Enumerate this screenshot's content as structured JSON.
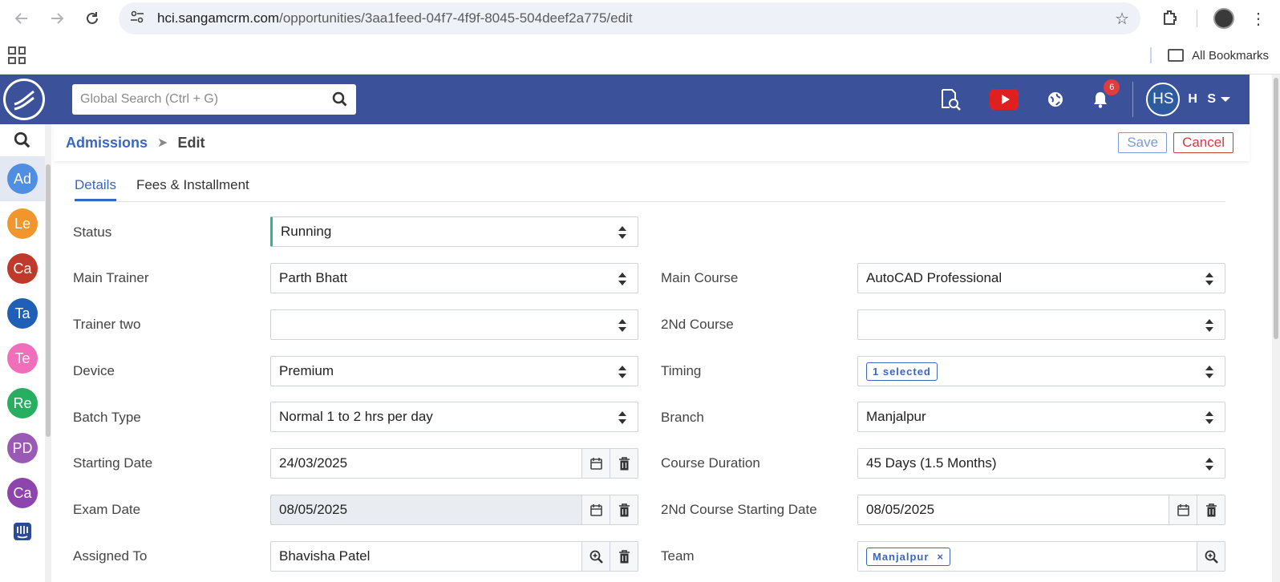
{
  "browser": {
    "url_host": "hci.sangamcrm.com",
    "url_path": "/opportunities/3aa1feed-04f7-4f9f-8045-504deef2a775/edit",
    "bookmarks_label": "All Bookmarks"
  },
  "header": {
    "search_placeholder": "Global Search (Ctrl + G)",
    "notification_count": "6",
    "avatar_initials": "HS",
    "user_name": "H S",
    "brand_color": "#3b5199"
  },
  "sidebar": {
    "items": [
      {
        "label": "Ad",
        "color": "#4f8ee0"
      },
      {
        "label": "Le",
        "color": "#f0962c"
      },
      {
        "label": "Ca",
        "color": "#c0392b"
      },
      {
        "label": "Ta",
        "color": "#1f5fb5"
      },
      {
        "label": "Te",
        "color": "#f16fba"
      },
      {
        "label": "Re",
        "color": "#27ae60"
      },
      {
        "label": "PD",
        "color": "#9b59b6"
      },
      {
        "label": "Ca",
        "color": "#8e44ad"
      }
    ]
  },
  "breadcrumb": {
    "module": "Admissions",
    "current": "Edit",
    "save_label": "Save",
    "cancel_label": "Cancel"
  },
  "tabs": [
    {
      "label": "Details"
    },
    {
      "label": "Fees & Installment"
    }
  ],
  "form": {
    "status": {
      "label": "Status",
      "value": "Running"
    },
    "main_trainer": {
      "label": "Main Trainer",
      "value": "Parth Bhatt"
    },
    "main_course": {
      "label": "Main Course",
      "value": "AutoCAD Professional"
    },
    "trainer_two": {
      "label": "Trainer two",
      "value": ""
    },
    "second_course": {
      "label": "2Nd Course",
      "value": ""
    },
    "device": {
      "label": "Device",
      "value": "Premium"
    },
    "timing": {
      "label": "Timing",
      "value": "1 selected"
    },
    "batch_type": {
      "label": "Batch Type",
      "value": "Normal 1 to 2 hrs per day"
    },
    "branch": {
      "label": "Branch",
      "value": "Manjalpur"
    },
    "starting_date": {
      "label": "Starting Date",
      "value": "24/03/2025"
    },
    "course_duration": {
      "label": "Course Duration",
      "value": "45 Days (1.5 Months)"
    },
    "exam_date": {
      "label": "Exam Date",
      "value": "08/05/2025"
    },
    "second_course_start": {
      "label": "2Nd Course Starting Date",
      "value": "08/05/2025"
    },
    "assigned_to": {
      "label": "Assigned To",
      "value": "Bhavisha Patel"
    },
    "team": {
      "label": "Team",
      "value": "Manjalpur",
      "chip_remove": "×"
    }
  }
}
